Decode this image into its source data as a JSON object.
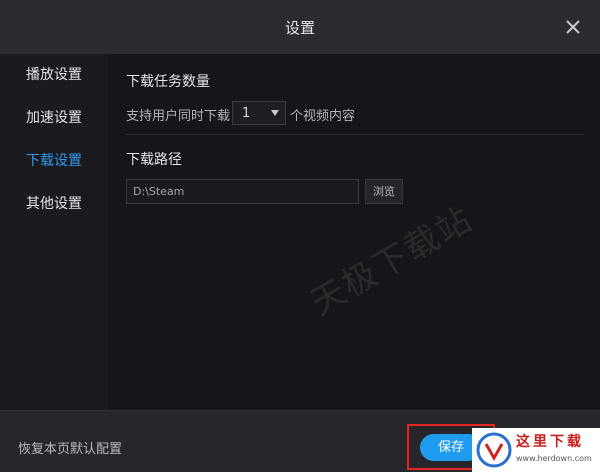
{
  "window": {
    "title": "设置",
    "close_icon": "close-icon"
  },
  "sidebar": {
    "items": [
      {
        "label": "播放设置",
        "active": false
      },
      {
        "label": "加速设置",
        "active": false
      },
      {
        "label": "下载设置",
        "active": true
      },
      {
        "label": "其他设置",
        "active": false
      }
    ],
    "active_color": "#2f9bf0"
  },
  "download": {
    "task_section_title": "下载任务数量",
    "concurrent_prefix": "支持用户同时下载",
    "concurrent_value": "1",
    "concurrent_suffix": "个视频内容",
    "path_section_title": "下载路径",
    "path_value": "D:\\Steam",
    "browse_label": "浏览"
  },
  "watermark": "天极下载站",
  "footer": {
    "restore_label": "恢复本页默认配置",
    "save_label": "保存",
    "save_color": "#1f9bf0",
    "highlight_color": "#e5251f"
  },
  "site_logo": {
    "title": "这里下载",
    "url": "www.herdown.com"
  }
}
